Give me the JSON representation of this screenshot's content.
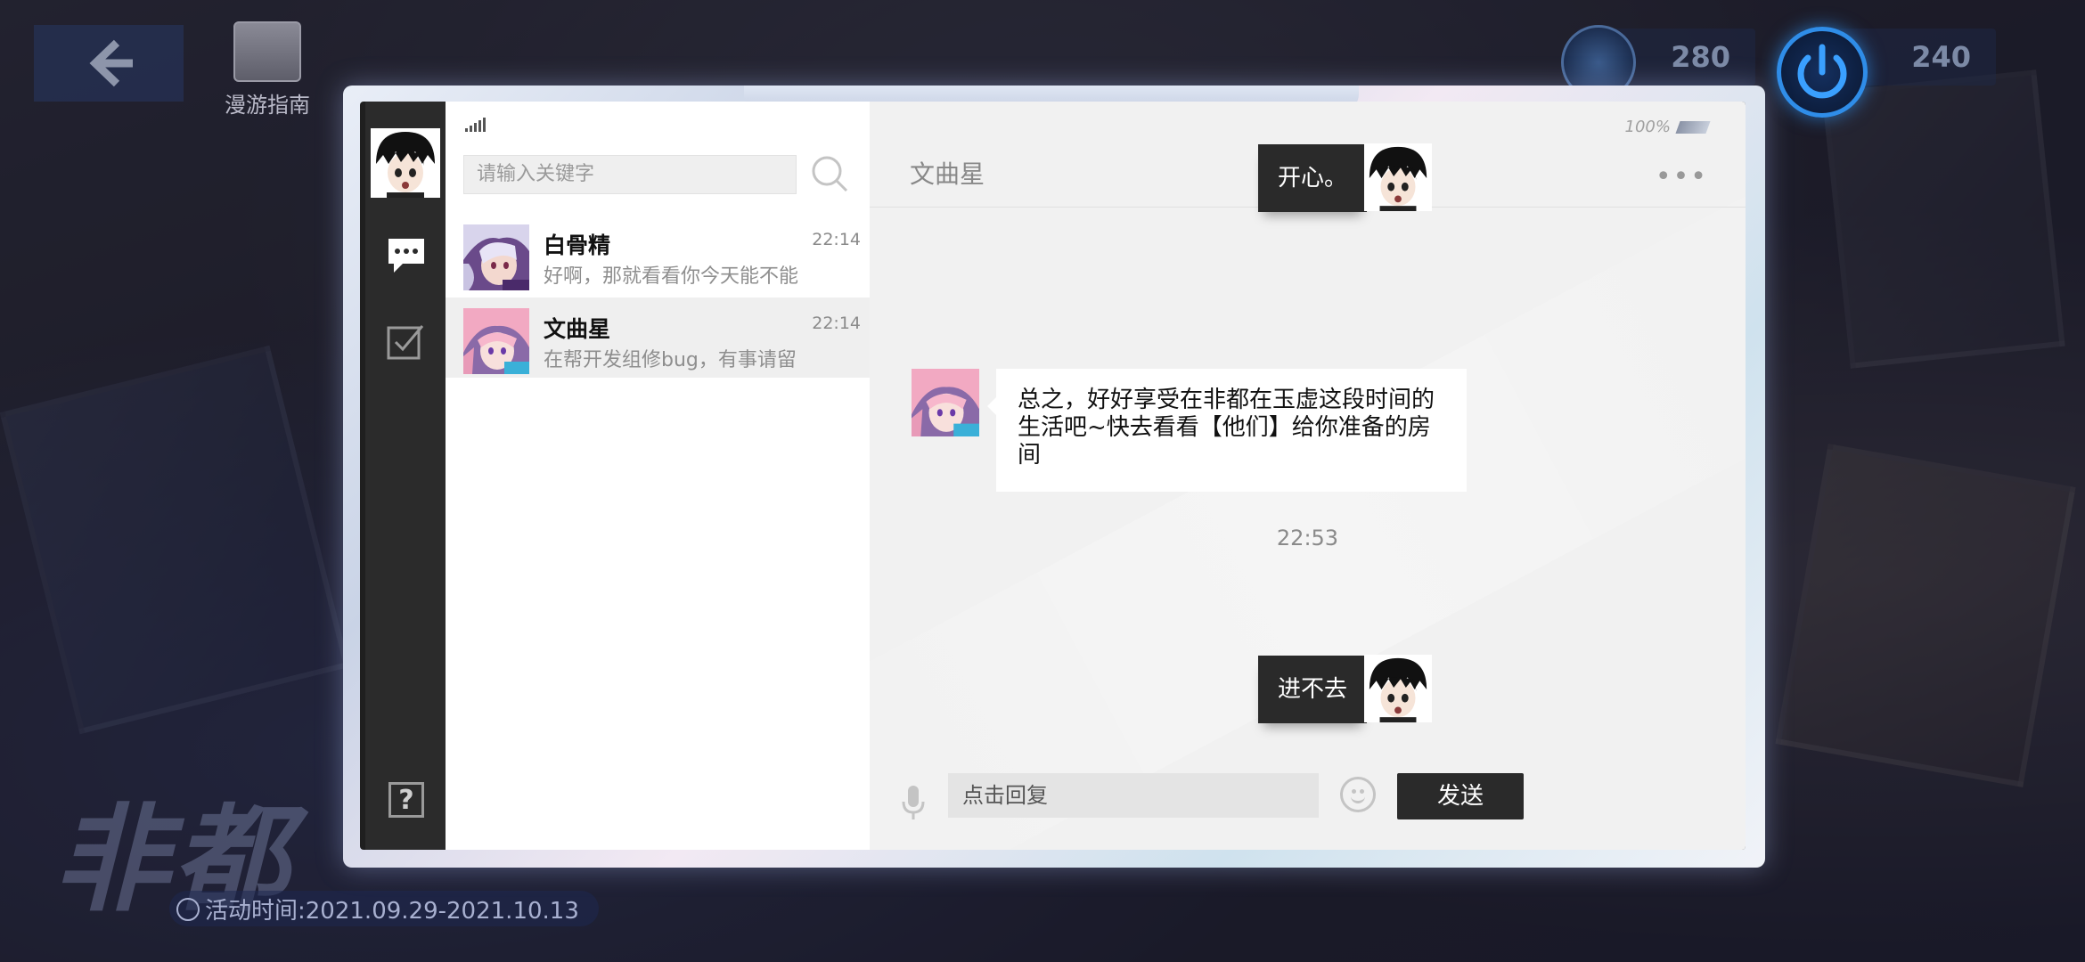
{
  "hud": {
    "guide_label": "漫游指南",
    "resource1_value": "280",
    "resource2_value": "240"
  },
  "event": {
    "title": "非都",
    "time": "活动时间:2021.09.29-2021.10.13"
  },
  "contacts": {
    "search_placeholder": "请输入关键字",
    "items": [
      {
        "name": "白骨精",
        "time": "22:14",
        "preview": "好啊，那就看看你今天能不能"
      },
      {
        "name": "文曲星",
        "time": "22:14",
        "preview": "在帮开发组修bug，有事请留"
      }
    ]
  },
  "chat": {
    "battery": "100%",
    "title": "文曲星",
    "more": "•••",
    "messages": [
      {
        "side": "right",
        "text": "开心。"
      },
      {
        "side": "left",
        "text": "总之，好好享受在非都在玉虚这段时间的生活吧~快去看看【他们】给你准备的房间"
      },
      {
        "side": "right",
        "text": "进不去"
      }
    ],
    "timestamp": "22:53",
    "reply_placeholder": "点击回复",
    "send_label": "发送"
  },
  "rail": {
    "help_label": "?"
  },
  "colors": {
    "accent_blue": "#2f8de8",
    "bubble_dark": "#2a2a2a",
    "selected_row": "#efefef"
  }
}
